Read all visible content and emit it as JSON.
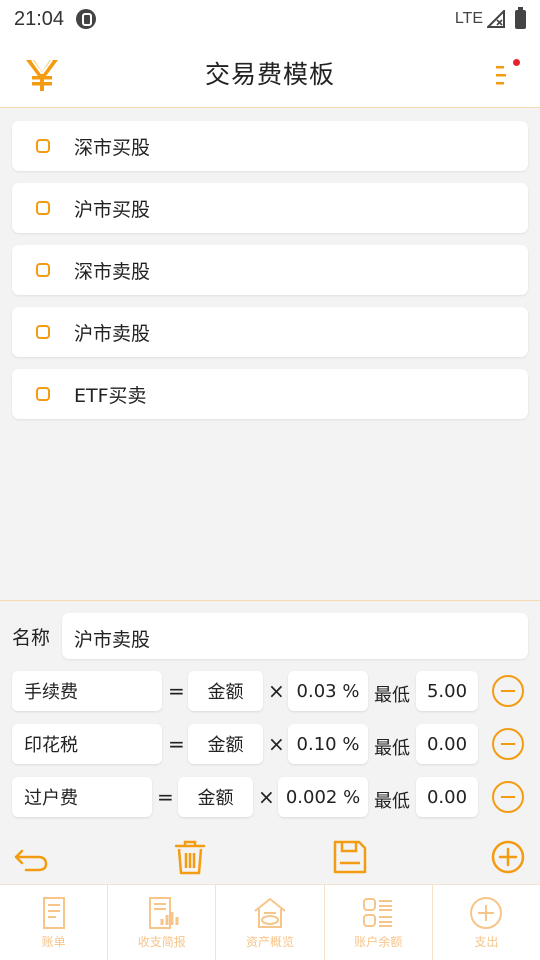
{
  "status": {
    "time": "21:04",
    "network": "LTE"
  },
  "header": {
    "title": "交易费模板"
  },
  "templates": [
    {
      "label": "深市买股"
    },
    {
      "label": "沪市买股"
    },
    {
      "label": "深市卖股"
    },
    {
      "label": "沪市卖股"
    },
    {
      "label": "ETF买卖"
    }
  ],
  "editor": {
    "name_label": "名称",
    "name_value": "沪市卖股",
    "fees": [
      {
        "name": "手续费",
        "eq": "=",
        "base": "金额",
        "times": "×",
        "rate": "0.03 %",
        "min_label": "最低",
        "min_value": "5.00"
      },
      {
        "name": "印花税",
        "eq": "=",
        "base": "金额",
        "times": "×",
        "rate": "0.10 %",
        "min_label": "最低",
        "min_value": "0.00"
      },
      {
        "name": "过户费",
        "eq": "=",
        "base": "金额",
        "times": "×",
        "rate": "0.002 %",
        "min_label": "最低",
        "min_value": "0.00"
      }
    ]
  },
  "tabs": [
    {
      "label": "账单",
      "icon": "bill-icon"
    },
    {
      "label": "收支简报",
      "icon": "report-icon"
    },
    {
      "label": "资产概览",
      "icon": "assets-icon"
    },
    {
      "label": "账户余额",
      "icon": "balance-icon"
    },
    {
      "label": "支出",
      "icon": "add-expense-icon"
    }
  ],
  "colors": {
    "accent": "#f39c12",
    "tab_text": "#f7c58a",
    "divider": "#f4d9b3",
    "badge": "#e8222a"
  }
}
